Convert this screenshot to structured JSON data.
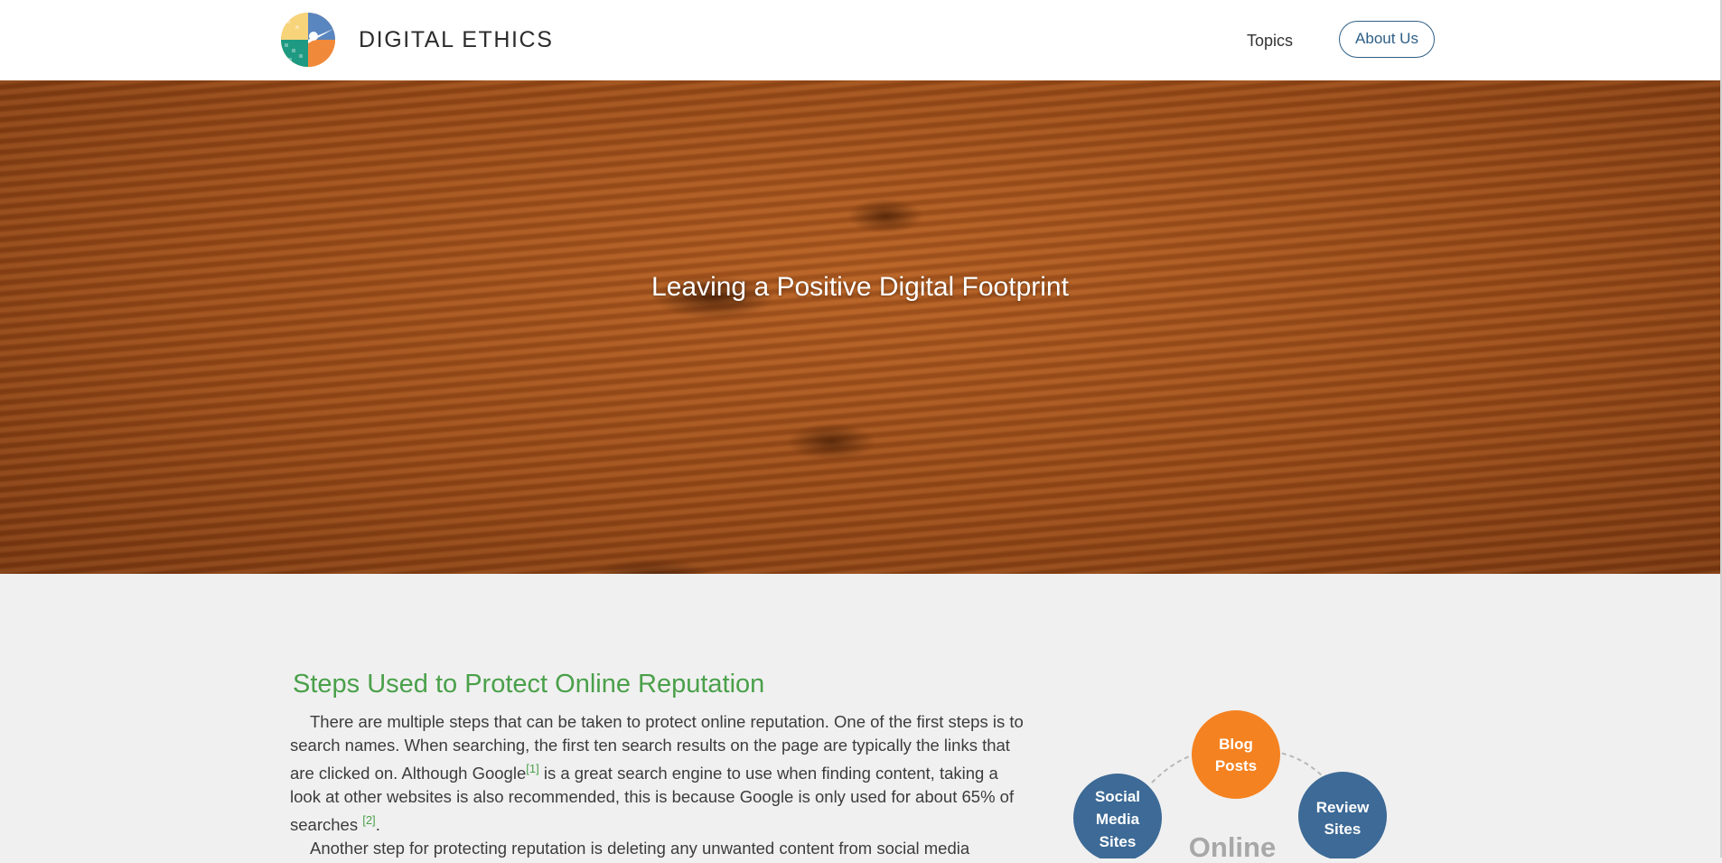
{
  "header": {
    "brand": "DIGITAL ETHICS",
    "nav": {
      "topics": "Topics",
      "about": "About Us"
    }
  },
  "hero": {
    "title": "Leaving a Positive Digital Footprint"
  },
  "article": {
    "heading": "Steps Used to Protect Online Reputation",
    "para1": {
      "text_a": "There are multiple steps that can be taken to protect online reputation. One of the first steps is to search names. When searching, the first ten search results on the page are typically the links that are clicked on. Although Google",
      "ref1": "[1]",
      "text_b": " is a great search engine to use when finding content, taking a look at other websites is also recommended, this is because Google is only used for about 65% of searches ",
      "ref2": "[2]",
      "text_c": "."
    },
    "para2": "Another step for protecting reputation is deleting any unwanted content from social media"
  },
  "diagram": {
    "nodes": {
      "blog": [
        "Blog",
        "Posts"
      ],
      "social": [
        "Social",
        "Media",
        "Sites"
      ],
      "review": [
        "Review",
        "Sites"
      ]
    },
    "center_label": "Online"
  },
  "colors": {
    "accent_green": "#4aa04a",
    "nav_blue": "#2f5f86",
    "node_orange": "#f58220",
    "node_blue": "#3d6a96"
  }
}
